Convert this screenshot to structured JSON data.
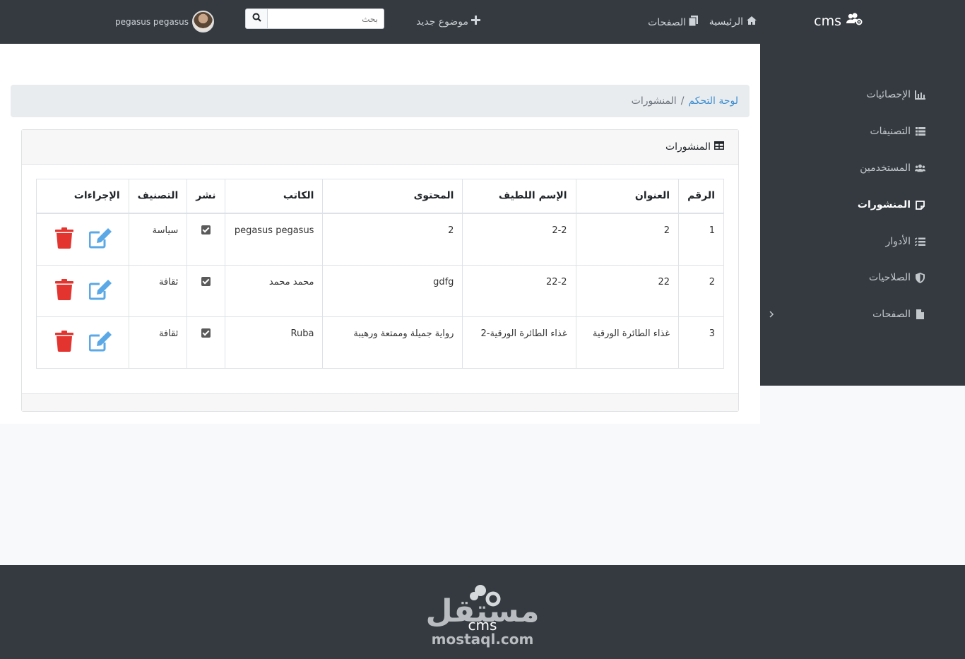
{
  "brand": {
    "name": "cms"
  },
  "nav": {
    "home": "الرئيسية",
    "pages": "الصفحات",
    "new_topic": "موضوع جديد"
  },
  "search": {
    "placeholder": "بحث"
  },
  "user": {
    "name": "pegasus pegasus"
  },
  "sidebar": {
    "items": [
      {
        "label": "الإحصائيات",
        "icon": "chart-icon"
      },
      {
        "label": "التصنيفات",
        "icon": "list-icon"
      },
      {
        "label": "المستخدمين",
        "icon": "users-icon"
      },
      {
        "label": "المنشورات",
        "icon": "note-icon",
        "active": true
      },
      {
        "label": "الأدوار",
        "icon": "list-check-icon"
      },
      {
        "label": "الصلاحيات",
        "icon": "shield-icon"
      },
      {
        "label": "الصفحات",
        "icon": "file-icon"
      }
    ]
  },
  "breadcrumb": {
    "home": "لوحة التحكم",
    "separator": "/",
    "current": "المنشورات"
  },
  "card": {
    "title": "المنشورات"
  },
  "table": {
    "headers": [
      "الرقم",
      "العنوان",
      "الإسم اللطيف",
      "المحتوى",
      "الكاتب",
      "نشر",
      "التصنيف",
      "الإجراءات"
    ],
    "rows": [
      {
        "id": "1",
        "title": "2",
        "slug": "2-2",
        "content": "2",
        "author": "pegasus pegasus",
        "published": true,
        "category": "سياسة"
      },
      {
        "id": "2",
        "title": "22",
        "slug": "22-2",
        "content": "gdfg",
        "author": "محمد محمد",
        "published": true,
        "category": "ثقافة"
      },
      {
        "id": "3",
        "title": "غذاء الطائرة الورقية",
        "slug": "غذاء الطائرة الورقية-2",
        "content": "رواية جميلة وممتعة ورهيبة",
        "author": "Ruba",
        "published": true,
        "category": "ثقافة"
      }
    ]
  },
  "footer": {
    "logo_ar": "مستقل",
    "logo_cms": "cms",
    "logo_domain": "mostaql.com"
  },
  "colors": {
    "dark": "#343a40",
    "link": "#3d8fd1",
    "edit": "#5aa9e6",
    "delete": "#e3342f"
  }
}
